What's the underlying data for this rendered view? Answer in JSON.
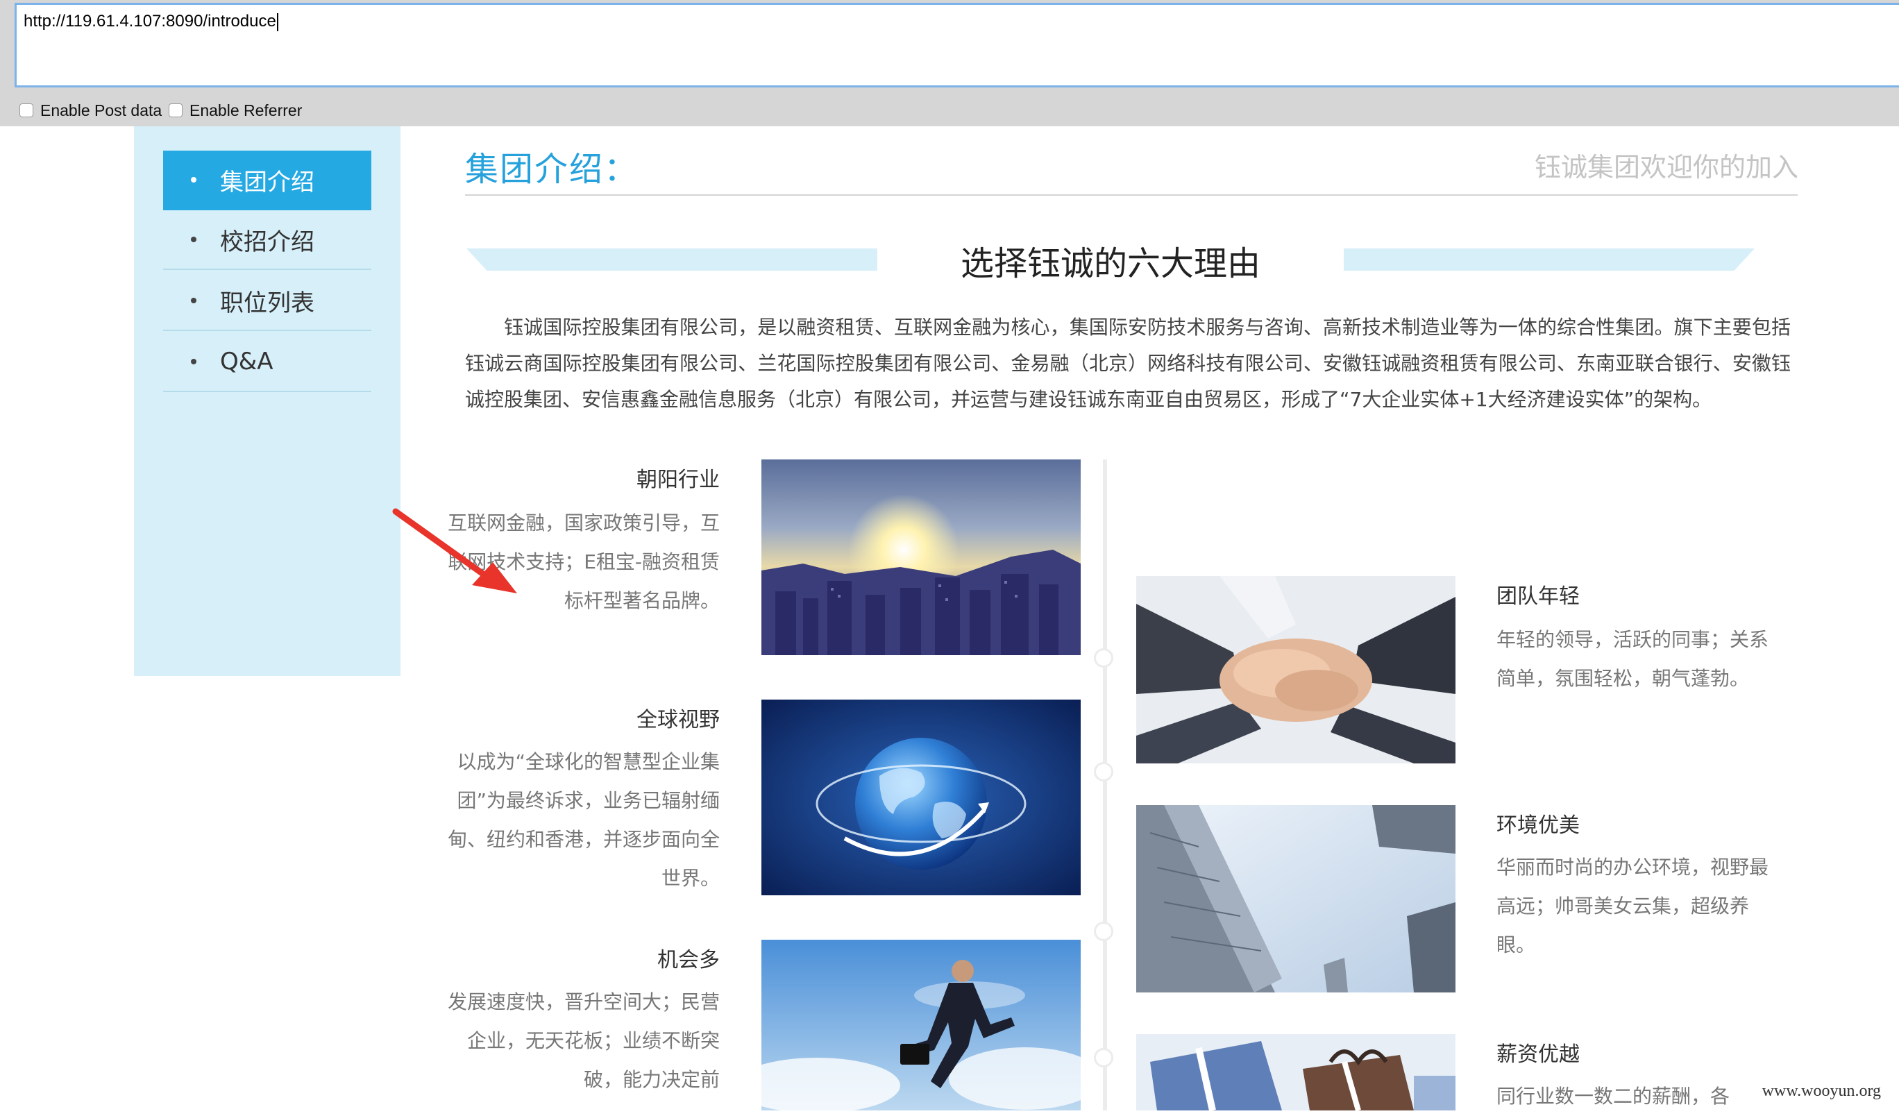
{
  "browser": {
    "url": "http://119.61.4.107:8090/introduce",
    "enable_post_data_label": "Enable Post data",
    "enable_referrer_label": "Enable Referrer"
  },
  "sidebar": {
    "items": [
      {
        "label": "集团介绍",
        "active": true
      },
      {
        "label": "校招介绍",
        "active": false
      },
      {
        "label": "职位列表",
        "active": false
      },
      {
        "label": "Q&A",
        "active": false
      }
    ]
  },
  "header": {
    "title": "集团介绍：",
    "welcome": "钰诚集团欢迎你的加入"
  },
  "reasons": {
    "title": "选择钰诚的六大理由",
    "intro": "钰诚国际控股集团有限公司，是以融资租赁、互联网金融为核心，集国际安防技术服务与咨询、高新技术制造业等为一体的综合性集团。旗下主要包括钰诚云商国际控股集团有限公司、兰花国际控股集团有限公司、金易融（北京）网络科技有限公司、安徽钰诚融资租赁有限公司、东南亚联合银行、安徽钰诚控股集团、安信惠鑫金融信息服务（北京）有限公司，并运营与建设钰诚东南亚自由贸易区，形成了“7大企业实体+1大经济建设实体”的架构。"
  },
  "features": {
    "left": [
      {
        "title": "朝阳行业",
        "desc": "互联网金融，国家政策引导，互联网技术支持；E租宝-融资租赁标杆型著名品牌。",
        "image_icon": "sunrise-city-photo"
      },
      {
        "title": "全球视野",
        "desc": "以成为“全球化的智慧型企业集团”为最终诉求，业务已辐射缅甸、纽约和香港，并逐步面向全世界。",
        "image_icon": "globe-photo"
      },
      {
        "title": "机会多",
        "desc": "发展速度快，晋升空间大；民营企业，无天花板；业绩不断突破，能力决定前",
        "image_icon": "businessman-running-photo"
      }
    ],
    "right": [
      {
        "title": "团队年轻",
        "desc": "年轻的领导，活跃的同事；关系简单，氛围轻松，朝气蓬勃。",
        "image_icon": "stacked-hands-photo"
      },
      {
        "title": "环境优美",
        "desc": "华丽而时尚的办公环境，视野最高远；帅哥美女云集，超级养眼。",
        "image_icon": "skyscrapers-photo"
      },
      {
        "title": "薪资优越",
        "desc": "同行业数一数二的薪酬，各",
        "image_icon": "gift-boxes-photo"
      }
    ]
  },
  "annotation": {
    "icon": "red-arrow-icon",
    "color": "#e8342a"
  },
  "watermark": "www.wooyun.org",
  "colors": {
    "accent": "#25a9e3",
    "sidebar_bg": "#d6eff9",
    "title": "#25a1dc"
  }
}
